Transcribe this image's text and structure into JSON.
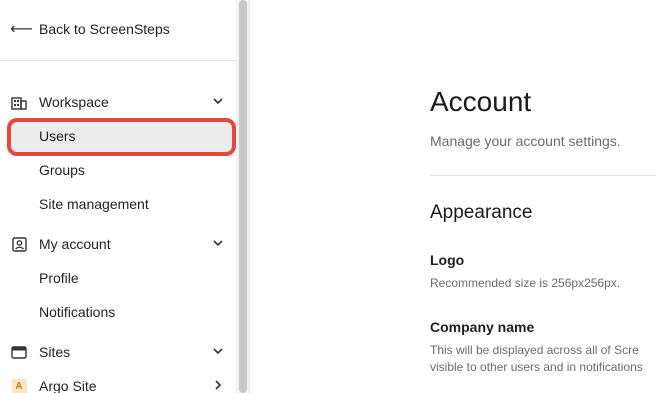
{
  "sidebar": {
    "back_label": "Back to ScreenSteps",
    "groups": [
      {
        "label": "Workspace",
        "icon": "building-icon",
        "expanded": true
      },
      {
        "label": "My account",
        "icon": "user-badge-icon",
        "expanded": true
      },
      {
        "label": "Sites",
        "icon": "browser-window-icon",
        "expanded": true
      },
      {
        "label": "Argo Site",
        "icon": "site-a-icon",
        "icon_text": "A",
        "expanded": false
      }
    ],
    "workspace_items": [
      "Users",
      "Groups",
      "Site management"
    ],
    "account_items": [
      "Profile",
      "Notifications"
    ],
    "highlight_color": "#e8453c"
  },
  "main": {
    "title": "Account",
    "subtitle": "Manage your account settings.",
    "section_title": "Appearance",
    "logo_label": "Logo",
    "logo_help": "Recommended size is 256px256px.",
    "company_label": "Company name",
    "company_help_line1": "This will be displayed across all of Scre",
    "company_help_line2": "visible to other users and in notifications"
  }
}
